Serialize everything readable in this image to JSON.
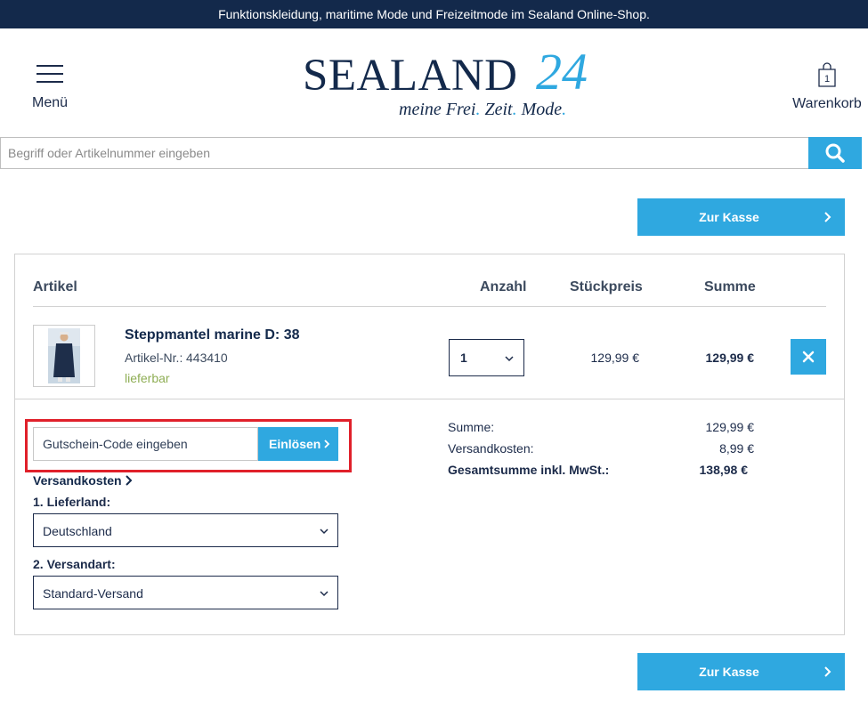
{
  "topbar": {
    "text": "Funktionskleidung, maritime Mode und Freizeitmode im Sealand Online-Shop."
  },
  "header": {
    "menu_label": "Menü",
    "logo": {
      "main": "SEALAND",
      "number": "24",
      "tagline_parts": [
        "meine Frei",
        ".",
        " Zeit",
        ".",
        " Mode",
        "."
      ]
    },
    "cart_label": "Warenkorb",
    "cart_count": "1"
  },
  "search": {
    "placeholder": "Begriff oder Artikelnummer eingeben"
  },
  "checkout": {
    "label": "Zur Kasse"
  },
  "table": {
    "headers": {
      "article": "Artikel",
      "quantity": "Anzahl",
      "unit_price": "Stückpreis",
      "sum": "Summe"
    },
    "items": [
      {
        "name": "Steppmantel marine D: 38",
        "number_label": "Artikel-Nr.:",
        "number": "443410",
        "availability": "lieferbar",
        "quantity": "1",
        "unit_price": "129,99 €",
        "sum": "129,99 €"
      }
    ]
  },
  "voucher": {
    "placeholder": "Gutschein-Code eingeben",
    "button_label": "Einlösen"
  },
  "shipping": {
    "link_label": "Versandkosten",
    "country_label": "1. Lieferland:",
    "country_value": "Deutschland",
    "method_label": "2. Versandart:",
    "method_value": "Standard-Versand"
  },
  "totals": {
    "subtotal_label": "Summe:",
    "subtotal_value": "129,99 €",
    "shipping_label": "Versandkosten:",
    "shipping_value": "8,99 €",
    "total_label": "Gesamtsumme inkl. MwSt.:",
    "total_value": "138,98 €"
  },
  "colors": {
    "navy": "#13294b",
    "accent": "#2fa8e0",
    "available": "#8fae55",
    "highlight": "#e0202a"
  }
}
